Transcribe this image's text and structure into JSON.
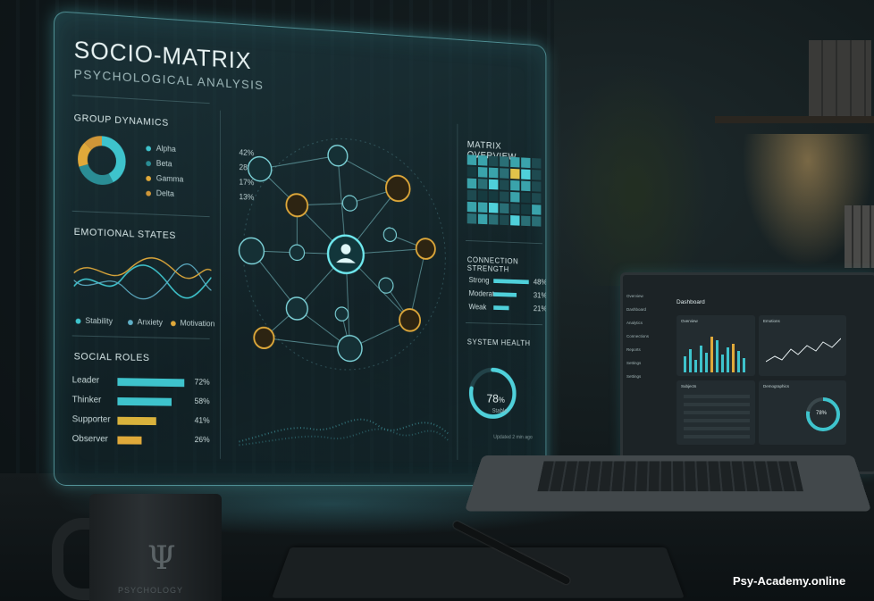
{
  "panel": {
    "title": "SOCIO-MATRIX",
    "subtitle": "PSYCHOLOGICAL ANALYSIS"
  },
  "group_dynamics": {
    "heading": "GROUP DYNAMICS",
    "items": [
      {
        "label": "Alpha",
        "pct": "42%",
        "color": "#3ec3cc"
      },
      {
        "label": "Beta",
        "pct": "28%",
        "color": "#2a8d95"
      },
      {
        "label": "Gamma",
        "pct": "17%",
        "color": "#e0a93a"
      },
      {
        "label": "Delta",
        "pct": "13%",
        "color": "#cf9638"
      }
    ]
  },
  "emotional_states": {
    "heading": "EMOTIONAL STATES",
    "legend": [
      {
        "label": "Stability",
        "color": "#3ec3cc"
      },
      {
        "label": "Anxiety",
        "color": "#5fb0c8"
      },
      {
        "label": "Motivation",
        "color": "#e0a93a"
      }
    ]
  },
  "social_roles": {
    "heading": "SOCIAL ROLES",
    "items": [
      {
        "label": "Leader",
        "pct": "72%",
        "value": 0.72,
        "color": "#3ec3cc"
      },
      {
        "label": "Thinker",
        "pct": "58%",
        "value": 0.58,
        "color": "#3ec3cc"
      },
      {
        "label": "Supporter",
        "pct": "41%",
        "value": 0.41,
        "color": "#d9b23c"
      },
      {
        "label": "Observer",
        "pct": "26%",
        "value": 0.26,
        "color": "#e0a93a"
      }
    ]
  },
  "matrix_overview": {
    "heading": "MATRIX OVERVIEW"
  },
  "connection_strength": {
    "heading": "CONNECTION STRENGTH",
    "items": [
      {
        "label": "Strong",
        "pct": "48%",
        "value": 0.48
      },
      {
        "label": "Moderate",
        "pct": "31%",
        "value": 0.31
      },
      {
        "label": "Weak",
        "pct": "21%",
        "value": 0.21
      }
    ]
  },
  "system_health": {
    "heading": "SYSTEM HEALTH",
    "value": "78",
    "unit": "%",
    "status": "Stable",
    "updated": "Updated 2 min ago",
    "fraction": 0.78
  },
  "laptop": {
    "title": "Dashboard",
    "nav": [
      "Overview",
      "Dashboard",
      "Analytics",
      "Connections",
      "Reports",
      "Settings",
      "Settings"
    ],
    "cards": {
      "overview": "Overview",
      "emotions": "Emotions",
      "subjects": "Subjects",
      "demographics": "Demographics"
    },
    "ring": "78%"
  },
  "mug": {
    "symbol": "Ψ",
    "text": "PSYCHOLOGY"
  },
  "watermark": "Psy-Academy.online",
  "colors": {
    "teal": "#3ec3cc",
    "amber": "#e0a93a"
  }
}
